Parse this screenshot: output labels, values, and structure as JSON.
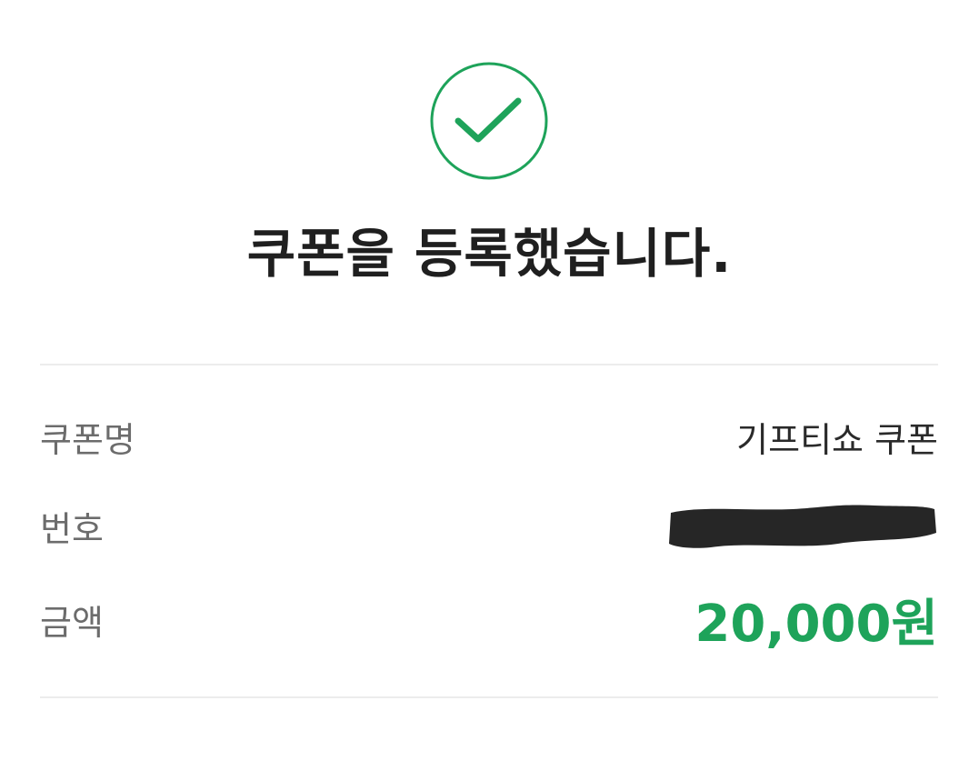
{
  "status": {
    "icon": "check-circle-icon",
    "color": "#1ea35a",
    "message": "쿠폰을 등록했습니다."
  },
  "details": {
    "coupon_name": {
      "label": "쿠폰명",
      "value": "기프티쇼 쿠폰"
    },
    "number": {
      "label": "번호",
      "value_icon": "redaction-mark"
    },
    "amount": {
      "label": "금액",
      "value": "20,000원"
    }
  },
  "colors": {
    "accent": "#1ea35a",
    "label_text": "#6c6c6c",
    "value_text": "#2a2a2a",
    "divider": "#ececec"
  }
}
